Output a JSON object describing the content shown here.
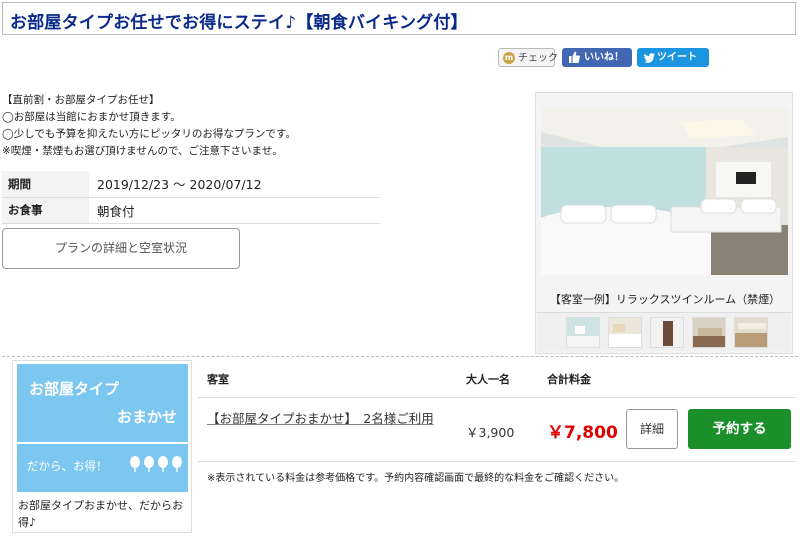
{
  "header": {
    "title": "お部屋タイプお任せでお得にステイ♪【朝食バイキング付】"
  },
  "social": {
    "check_label": "チェック",
    "like_label": "いいね！",
    "tweet_label": "ツイート"
  },
  "description": [
    "【直前割・お部屋タイプお任せ】",
    "◯お部屋は当館におまかせ頂きます。",
    "◯少しでも予算を抑えたい方にピッタリのお得なプランです。",
    "※喫煙・禁煙もお選び頂けませんので、ご注意下さいませ。"
  ],
  "info": {
    "period_label": "期間",
    "period_value": "2019/12/23 〜 2020/07/12",
    "meal_label": "お食事",
    "meal_value": "朝食付"
  },
  "plan_button": "プランの詳細と空室状況",
  "photo": {
    "caption": "【客室一例】リラックスツインルーム（禁煙）",
    "thumb_count": 5
  },
  "room_image": {
    "line1": "お部屋タイプ",
    "line2": "おまかせ",
    "line3": "だから、お得！",
    "caption": "お部屋タイプおまかせ、だからお得♪",
    "bg_color": "#7cc7f0"
  },
  "table": {
    "col_room": "客室",
    "col_adult": "大人一名",
    "col_total": "合計料金",
    "room_name": "【お部屋タイプおまかせ】　2名様ご利用",
    "price_adult": "￥3,900",
    "price_total": "￥7,800",
    "detail_button": "詳細",
    "book_button": "予約する",
    "note": "※表示されている料金は参考価格です。予約内容確認画面で最終的な料金をご確認ください。"
  },
  "colors": {
    "title": "#0a2a8a",
    "price": "#e00000",
    "book": "#1a8f2a",
    "like": "#4267b2",
    "tweet": "#1b95e0"
  }
}
